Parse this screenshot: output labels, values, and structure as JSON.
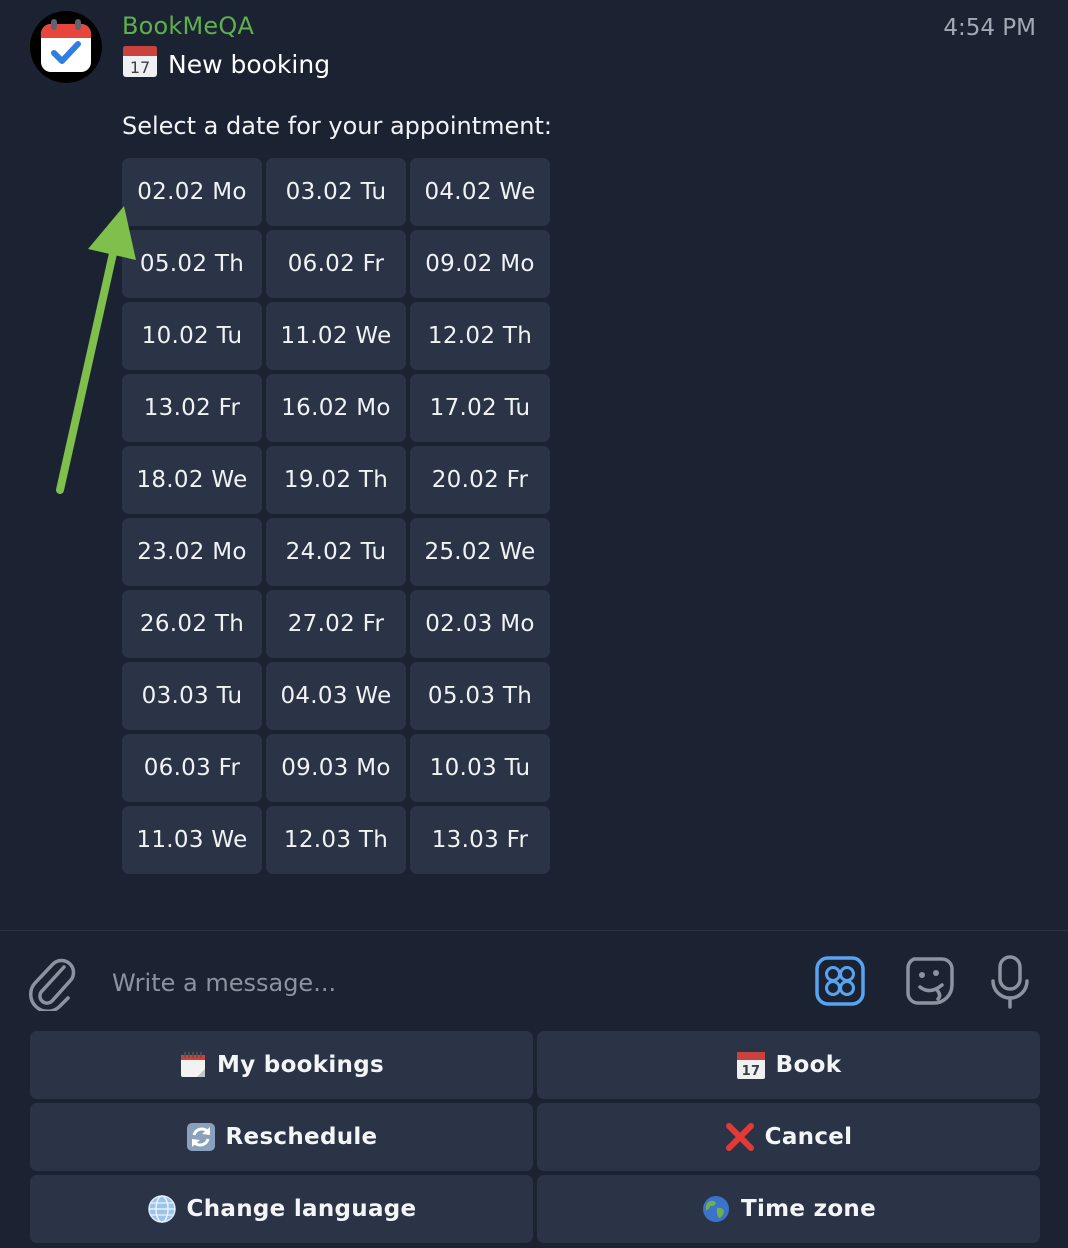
{
  "message": {
    "sender": "BookMeQA",
    "time": "4:54 PM",
    "title": "New booking",
    "prompt": "Select a date for your appointment:"
  },
  "dates": [
    "02.02 Mo",
    "03.02 Tu",
    "04.02 We",
    "05.02 Th",
    "06.02 Fr",
    "09.02 Mo",
    "10.02 Tu",
    "11.02 We",
    "12.02 Th",
    "13.02 Fr",
    "16.02 Mo",
    "17.02 Tu",
    "18.02 We",
    "19.02 Th",
    "20.02 Fr",
    "23.02 Mo",
    "24.02 Tu",
    "25.02 We",
    "26.02 Th",
    "27.02 Fr",
    "02.03 Mo",
    "03.03 Tu",
    "04.03 We",
    "05.03 Th",
    "06.03 Fr",
    "09.03 Mo",
    "10.03 Tu",
    "11.03 We",
    "12.03 Th",
    "13.03 Fr"
  ],
  "composer": {
    "placeholder": "Write a message..."
  },
  "keyboard": [
    {
      "label": "My bookings",
      "icon": "spiral-calendar-icon"
    },
    {
      "label": "Book",
      "icon": "calendar-icon"
    },
    {
      "label": "Reschedule",
      "icon": "arrows-refresh-icon"
    },
    {
      "label": "Cancel",
      "icon": "cross-mark-icon"
    },
    {
      "label": "Change language",
      "icon": "globe-icon"
    },
    {
      "label": "Time zone",
      "icon": "earth-icon"
    }
  ],
  "colors": {
    "background": "#1b2333",
    "button": "#2a3446",
    "sender": "#5db04d",
    "accent": "#5aa3ef",
    "arrow": "#7fbf4b"
  }
}
